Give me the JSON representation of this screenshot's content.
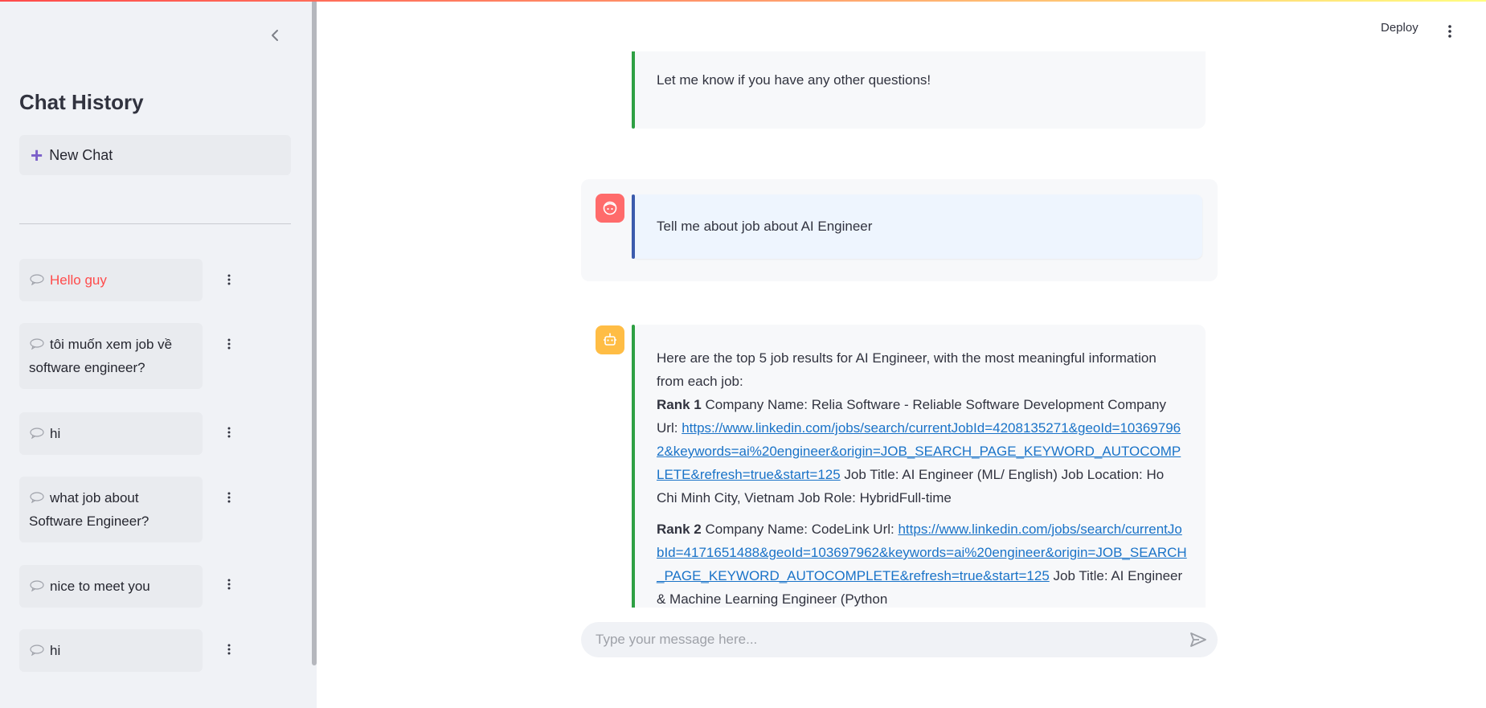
{
  "sidebar": {
    "title": "Chat History",
    "new_chat_label": "New Chat",
    "chats": [
      {
        "label": "Hello guy",
        "active": true
      },
      {
        "label": "tôi muốn xem job về software engineer?",
        "active": false
      },
      {
        "label": "hi",
        "active": false
      },
      {
        "label": "what job about Software Engineer?",
        "active": false
      },
      {
        "label": "nice to meet you",
        "active": false
      },
      {
        "label": "hi",
        "active": false
      }
    ]
  },
  "header": {
    "deploy_label": "Deploy"
  },
  "messages": {
    "prev_assistant_tail": "Let me know if you have any other questions!",
    "user_message": "Tell me about job about AI Engineer",
    "assistant": {
      "intro": "Here are the top 5 job results for AI Engineer, with the most meaningful information from each job:",
      "rank1": {
        "rank_label": "Rank 1",
        "company_text": " Company Name: Relia Software - Reliable Software Development Company Url:",
        "url": "https://www.linkedin.com/jobs/search/currentJobId=4208135271&geoId=103697962&keywords=ai%20engineer&origin=JOB_SEARCH_PAGE_KEYWORD_AUTOCOMPLETE&refresh=true&start=125",
        "details": " Job Title: AI Engineer (ML/ English) Job Location: Ho Chi Minh City, Vietnam Job Role: HybridFull-time"
      },
      "rank2": {
        "rank_label": "Rank 2",
        "company_text": " Company Name: CodeLink Url:",
        "url": "https://www.linkedin.com/jobs/search/currentJobId=4171651488&geoId=103697962&keywords=ai%20engineer&origin=JOB_SEARCH_PAGE_KEYWORD_AUTOCOMPLETE&refresh=true&start=125",
        "details": " Job Title: AI Engineer & Machine Learning Engineer (Python"
      }
    }
  },
  "input": {
    "placeholder": "Type your message here..."
  },
  "colors": {
    "accent_red": "#ff4b4b",
    "assistant_bar": "#2ea043",
    "user_bar": "#3b5bad",
    "link": "#1a73c8",
    "plus_purple": "#7b5fc9"
  },
  "icons": {
    "collapse": "chevron-left-icon",
    "new_chat": "plus-icon",
    "chat_item": "speech-bubble-icon",
    "chat_menu": "kebab-menu-icon",
    "main_menu": "kebab-menu-icon",
    "user_avatar": "user-face-icon",
    "assistant_avatar": "robot-icon",
    "send": "send-icon"
  }
}
